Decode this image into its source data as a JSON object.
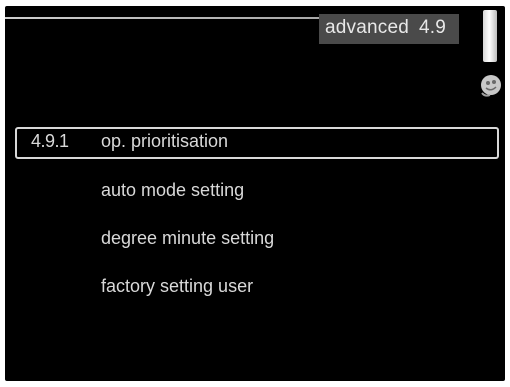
{
  "header": {
    "title": "advanced",
    "code": "4.9"
  },
  "icons": {
    "side_bar": "level-bar-icon",
    "avatar": "service-mascot-icon"
  },
  "menu": {
    "items": [
      {
        "number": "4.9.1",
        "label": "op. prioritisation",
        "selected": true
      },
      {
        "number": "",
        "label": "auto mode setting",
        "selected": false
      },
      {
        "number": "",
        "label": "degree minute setting",
        "selected": false
      },
      {
        "number": "",
        "label": "factory setting user",
        "selected": false
      }
    ]
  },
  "colors": {
    "background": "#000000",
    "text": "#d9d9d9",
    "title_bg": "#4a4a4a"
  }
}
